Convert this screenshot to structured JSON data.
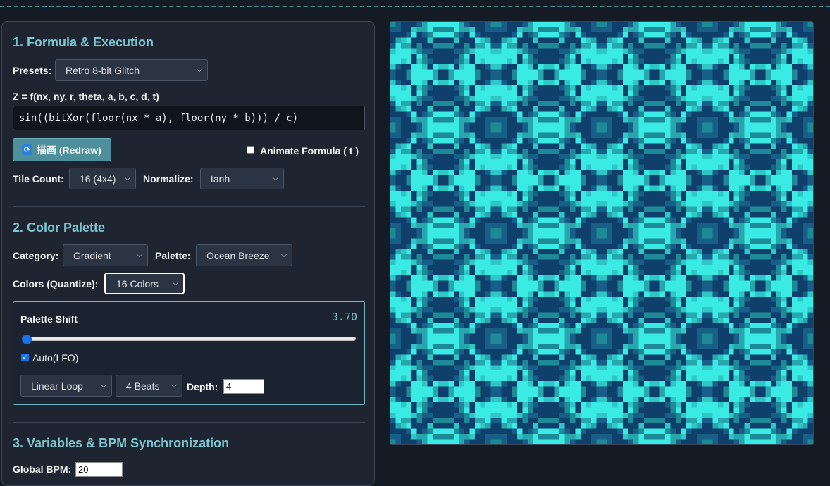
{
  "formula_section": {
    "title": "1. Formula & Execution",
    "presets_label": "Presets:",
    "preset_selected": "Retro 8-bit Glitch",
    "formula_label": "Z = f(nx, ny, r, theta, a, b, c, d, t)",
    "formula_value": "sin((bitXor(floor(nx * a), floor(ny * b))) / c)",
    "redraw_label": "描画 (Redraw)",
    "animate_label": "Animate Formula ( t )",
    "animate_checked": false,
    "tile_count_label": "Tile Count:",
    "tile_count_selected": "16 (4x4)",
    "normalize_label": "Normalize:",
    "normalize_selected": "tanh"
  },
  "palette_section": {
    "title": "2. Color Palette",
    "category_label": "Category:",
    "category_selected": "Gradient",
    "palette_label": "Palette:",
    "palette_selected": "Ocean Breeze",
    "quantize_label": "Colors (Quantize):",
    "quantize_selected": "16 Colors",
    "shift": {
      "label": "Palette Shift",
      "value_text": "3.70",
      "slider_fraction": 0.0,
      "auto_label": "Auto(LFO)",
      "auto_checked": true,
      "mode_selected": "Linear Loop",
      "beats_selected": "4 Beats",
      "depth_label": "Depth:",
      "depth_value": "4"
    }
  },
  "variables_section": {
    "title": "3. Variables & BPM Synchronization",
    "bpm_label": "Global BPM:",
    "bpm_value": "20"
  },
  "canvas": {
    "palette_colors": [
      "#39ebe4",
      "#2ec6c6",
      "#27a6ad",
      "#1f8a97",
      "#175f86",
      "#0f3f6b"
    ],
    "accent": "#7cc6cf"
  }
}
